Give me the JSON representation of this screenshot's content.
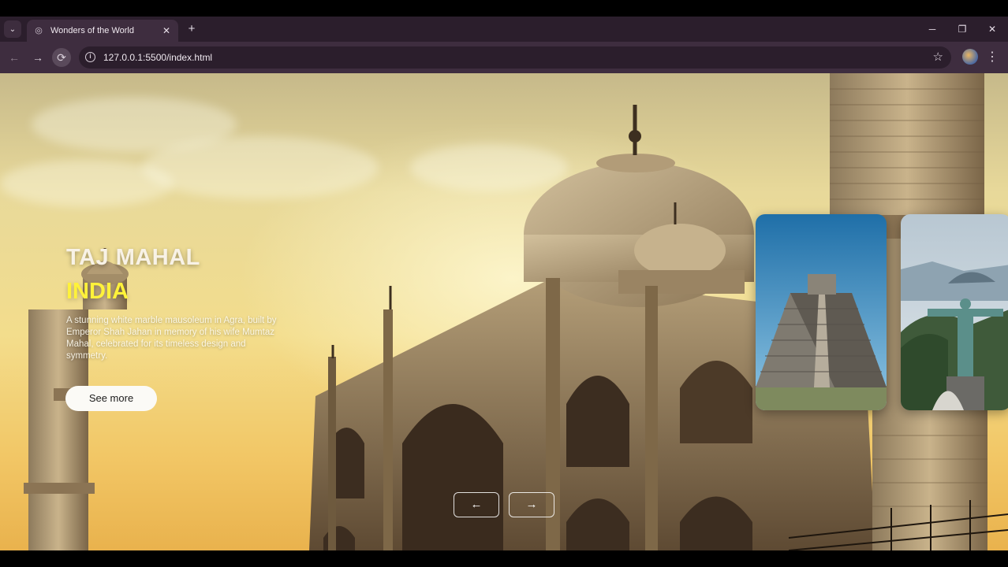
{
  "browser": {
    "tab_title": "Wonders of the World",
    "url": "127.0.0.1:5500/index.html",
    "tab_search_glyph": "⌄",
    "new_tab_glyph": "+",
    "close_glyph": "✕",
    "minimize_glyph": "─",
    "restore_glyph": "❐",
    "back_glyph": "←",
    "forward_glyph": "→",
    "reload_glyph": "⟳",
    "star_glyph": "☆",
    "menu_glyph": "⋮"
  },
  "hero": {
    "title": "TAJ MAHAL",
    "subtitle": "INDIA",
    "description": "A stunning white marble mausoleum in Agra, built by Emperor Shah Jahan in memory of his wife Mumtaz Mahal, celebrated for its timeless design and symmetry.",
    "button_label": "See more"
  },
  "cards": [
    {
      "name": "chichen-itza",
      "icon": "pyramid"
    },
    {
      "name": "christ-the-redeemer",
      "icon": "statue"
    }
  ],
  "controls": {
    "prev_glyph": "←",
    "next_glyph": "→"
  },
  "colors": {
    "accent": "#fff23a",
    "browser_frame": "#2b1e2c"
  }
}
